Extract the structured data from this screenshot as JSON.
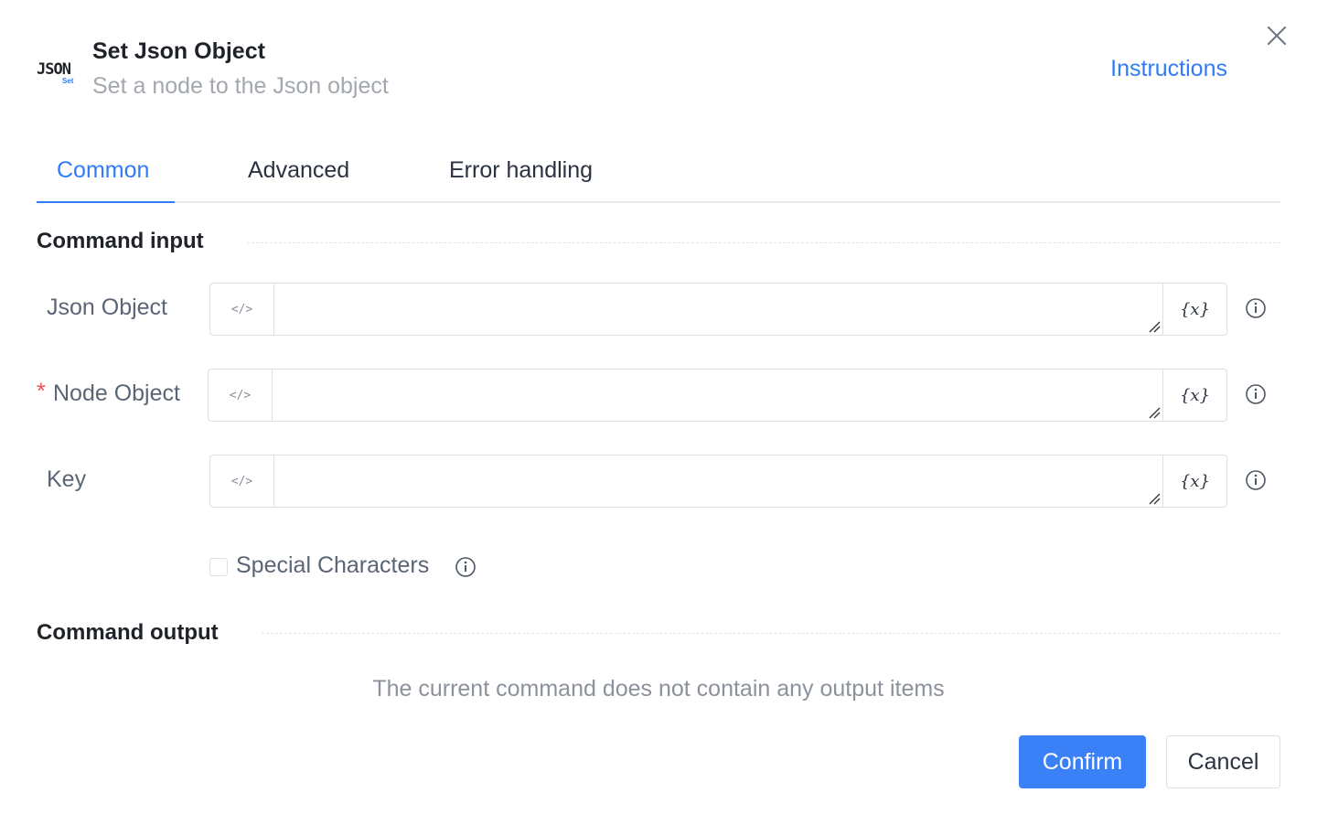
{
  "header": {
    "logo_text": "JSON",
    "logo_sub": "Set",
    "title": "Set Json Object",
    "subtitle": "Set a node to the Json object",
    "instructions_label": "Instructions"
  },
  "tabs": [
    {
      "label": "Common",
      "active": true
    },
    {
      "label": "Advanced",
      "active": false
    },
    {
      "label": "Error handling",
      "active": false
    }
  ],
  "sections": {
    "input_title": "Command input",
    "output_title": "Command output"
  },
  "fields": [
    {
      "label": "Json Object",
      "required": false,
      "value": "",
      "prefix": "</>",
      "suffix": "{x}"
    },
    {
      "label": "Node Object",
      "required": true,
      "value": "",
      "prefix": "</>",
      "suffix": "{x}"
    },
    {
      "label": "Key",
      "required": false,
      "value": "",
      "prefix": "</>",
      "suffix": "{x}"
    }
  ],
  "required_marker": "*",
  "special_characters": {
    "label": "Special Characters",
    "checked": false
  },
  "output_empty_text": "The current command does not contain any output items",
  "buttons": {
    "confirm": "Confirm",
    "cancel": "Cancel"
  },
  "colors": {
    "accent": "#2f7cf6",
    "required": "#f0504f",
    "muted": "#a3a8b0"
  }
}
